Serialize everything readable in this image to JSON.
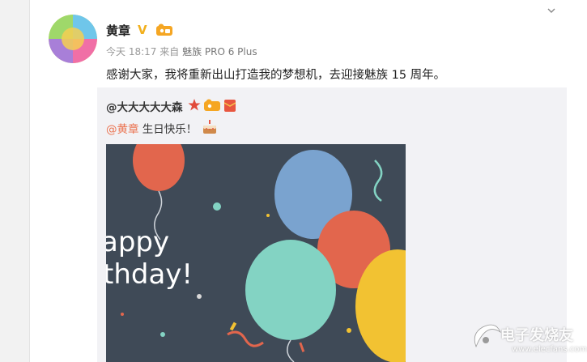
{
  "post": {
    "author": "黄章",
    "verified_mark": "V",
    "time": "今天 18:17",
    "source_prefix": "来自",
    "source": "魅族 PRO 6 Plus",
    "text": "感谢大家，我将重新出山打造我的梦想机，去迎接魅族 15 周年。"
  },
  "repost": {
    "author": "@大大大大大森",
    "mention": "@黄章",
    "message": " 生日快乐！",
    "image": {
      "text_line1": "appy",
      "text_line2": "thday!"
    }
  },
  "watermark": {
    "text": "电子发烧友",
    "url": "www.elecfans.com"
  },
  "icons": {
    "menu": "chevron-down-icon",
    "level": "level-badge-icon",
    "star": "star-icon",
    "cake": "birthday-cake-icon"
  },
  "colors": {
    "mention": "#eb7350",
    "verified": "#f2b01e",
    "image_bg": "#3f4a57",
    "balloon_red": "#e2664d",
    "balloon_blue": "#7aa3cf",
    "balloon_teal": "#83d3c3",
    "balloon_yellow": "#f2c232"
  }
}
